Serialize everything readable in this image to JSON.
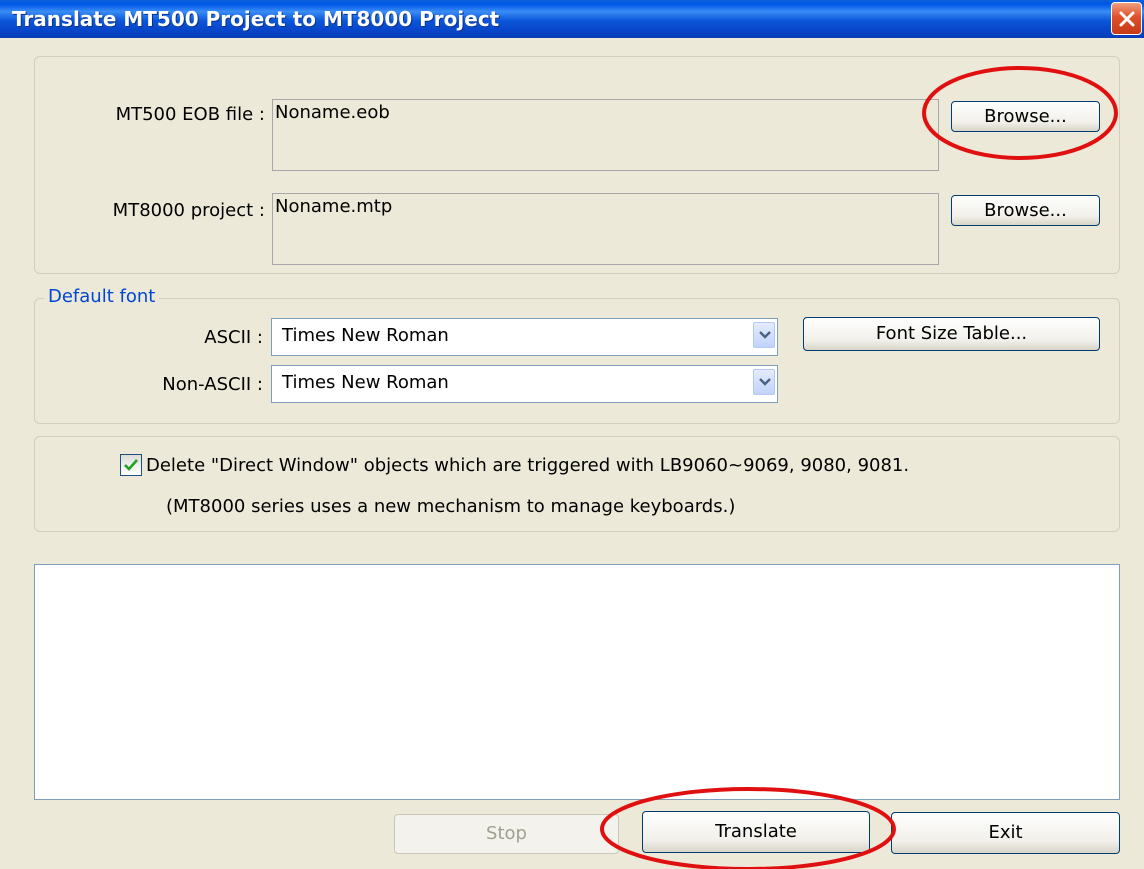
{
  "window": {
    "title": "Translate MT500 Project to MT8000 Project"
  },
  "files": {
    "eob_label": "MT500 EOB file :",
    "eob_value": "Noname.eob",
    "mtp_label": "MT8000 project :",
    "mtp_value": "Noname.mtp",
    "browse_label": "Browse..."
  },
  "default_font": {
    "legend": "Default font",
    "ascii_label": "ASCII :",
    "ascii_value": "Times New Roman",
    "nonascii_label": "Non-ASCII :",
    "nonascii_value": "Times New Roman",
    "font_size_table_label": "Font Size Table..."
  },
  "options": {
    "delete_direct_window_checked": true,
    "delete_direct_window_label": "Delete \"Direct Window\" objects which are triggered with LB9060~9069, 9080, 9081.",
    "note": "(MT8000 series uses a new mechanism to manage keyboards.)"
  },
  "footer": {
    "stop_label": "Stop",
    "translate_label": "Translate",
    "exit_label": "Exit"
  },
  "colors": {
    "title_bar": "#0a55d8",
    "legend_text": "#0046d5",
    "annotation_circle": "#e01010"
  }
}
